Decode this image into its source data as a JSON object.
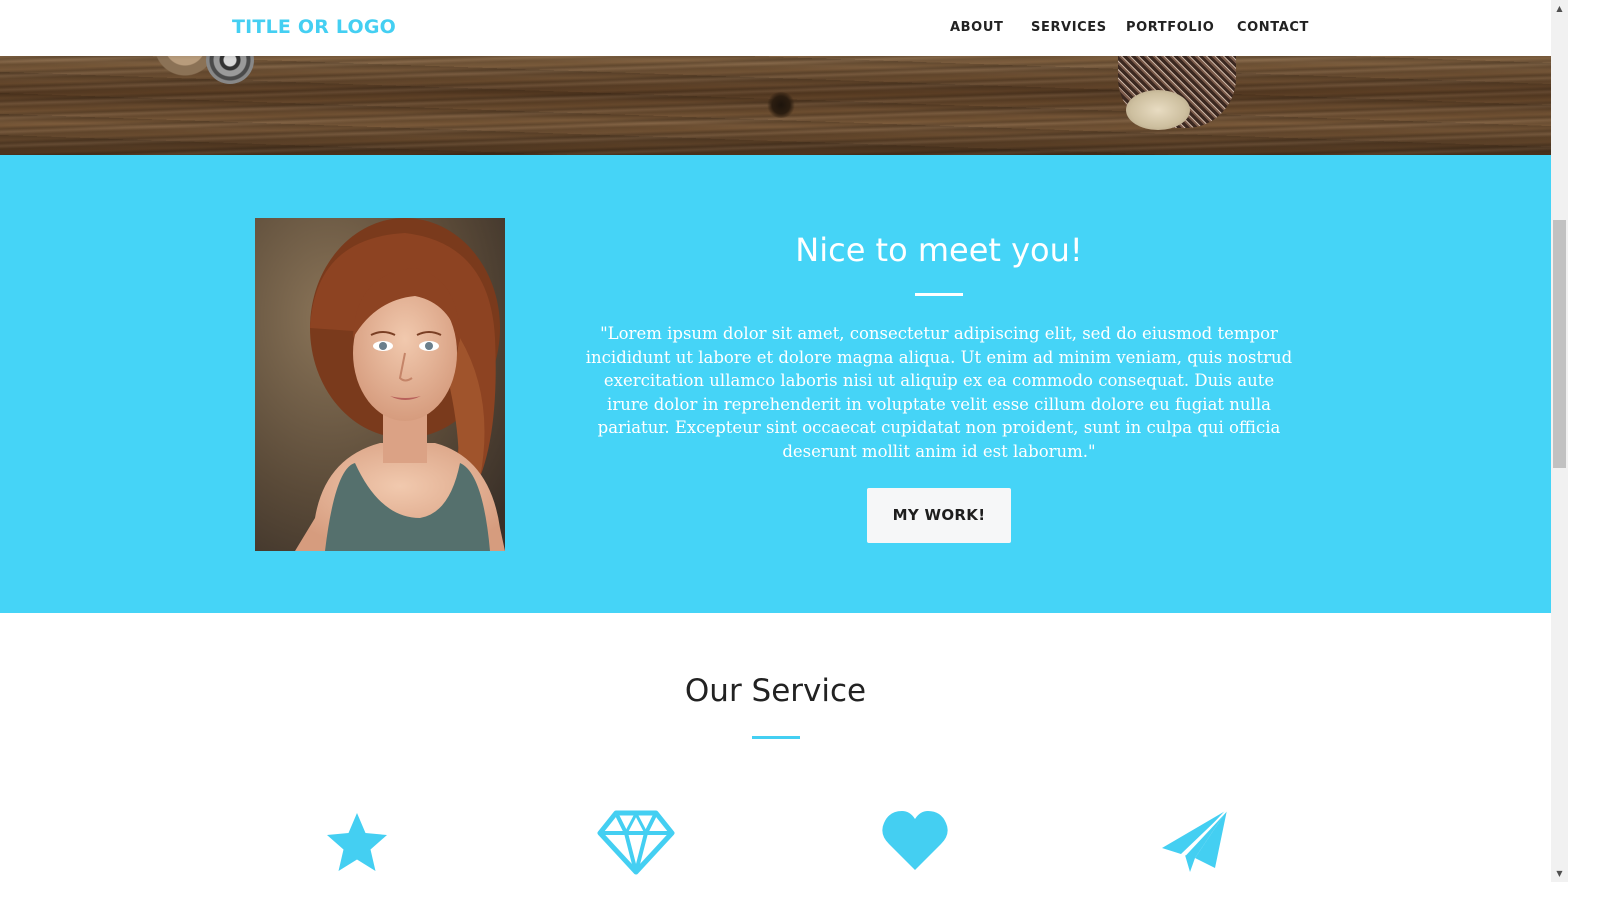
{
  "navbar": {
    "brand": "TITLE OR LOGO",
    "links": [
      {
        "label": "ABOUT"
      },
      {
        "label": "SERVICES"
      },
      {
        "label": "PORTFOLIO"
      },
      {
        "label": "CONTACT"
      }
    ]
  },
  "about": {
    "heading": "Nice to meet you!",
    "quote": "\"Lorem ipsum dolor sit amet, consectetur adipiscing elit, sed do eiusmod tempor incididunt ut labore et dolore magna aliqua. Ut enim ad minim veniam, quis nostrud exercitation ullamco laboris nisi ut aliquip ex ea commodo consequat. Duis aute irure dolor in reprehenderit in voluptate velit esse cillum dolore eu fugiat nulla pariatur. Excepteur sint occaecat cupidatat non proident, sunt in culpa qui officia deserunt mollit anim id est laborum.\"",
    "button": "MY WORK!",
    "portrait_icon": "portrait-photo"
  },
  "services": {
    "title": "Our Service",
    "icons": [
      "star-icon",
      "diamond-icon",
      "heart-icon",
      "paper-plane-icon"
    ]
  },
  "colors": {
    "accent": "#44cff2",
    "band": "#45d4f7",
    "text_dark": "#222222",
    "button_bg": "#f6f7f8"
  }
}
